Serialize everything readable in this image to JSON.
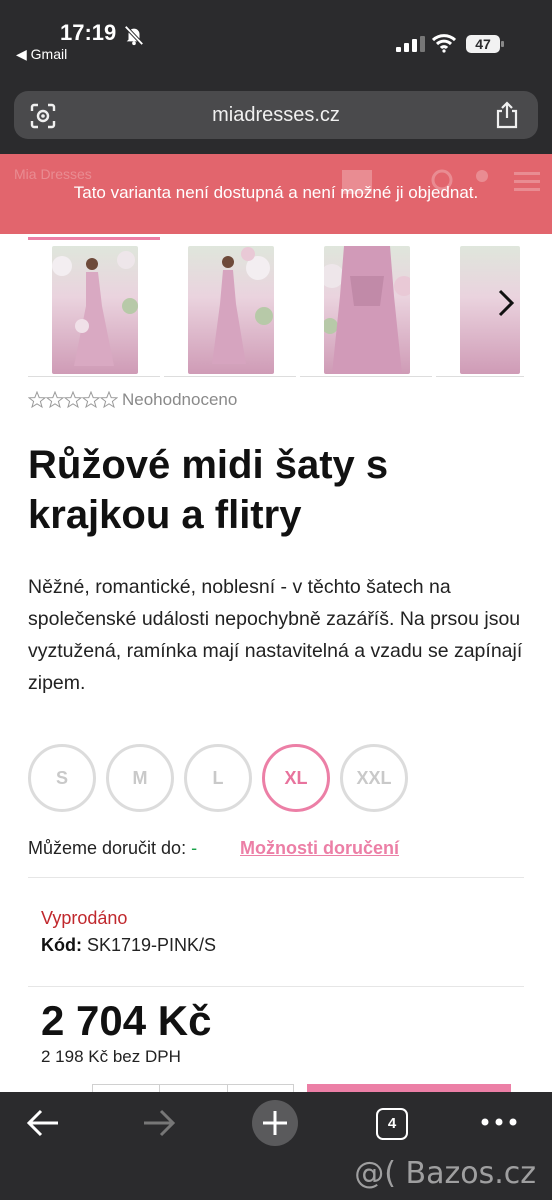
{
  "status_bar": {
    "time": "17:19",
    "back_app": "◀ Gmail",
    "battery": "47"
  },
  "browser": {
    "url": "miadresses.cz"
  },
  "banner": {
    "ghost_logo": "Mia Dresses",
    "message": "Tato varianta není dostupná a není možné ji objednat."
  },
  "product": {
    "rating_text": "Neohodnoceno",
    "title": "Růžové midi šaty s krajkou a flitry",
    "description": "Něžné, romantické, noblesní - v těchto šatech na společenské události nepochybně zazáříš. Na prsou jsou vyztužená, ramínka mají nastavitelná a vzadu se zapínají zipem.",
    "sizes": [
      "S",
      "M",
      "L",
      "XL",
      "XXL"
    ],
    "selected_size": "XL",
    "delivery_label": "Můžeme doručit do:",
    "delivery_value": "-",
    "delivery_link": "Možnosti doručení",
    "stock_status": "Vyprodáno",
    "code_label": "Kód:",
    "code_value": "SK1719-PINK/S",
    "price": "2 704 Kč",
    "price_net": "2 198 Kč bez DPH"
  },
  "toolbar": {
    "tabs_count": "4"
  },
  "watermark": "@( Bazos.cz",
  "colors": {
    "accent_pink": "#ec7fa6",
    "error_banner": "#e2656d",
    "sold_out_red": "#c0282d",
    "chrome_dark": "#2b2b2d"
  }
}
